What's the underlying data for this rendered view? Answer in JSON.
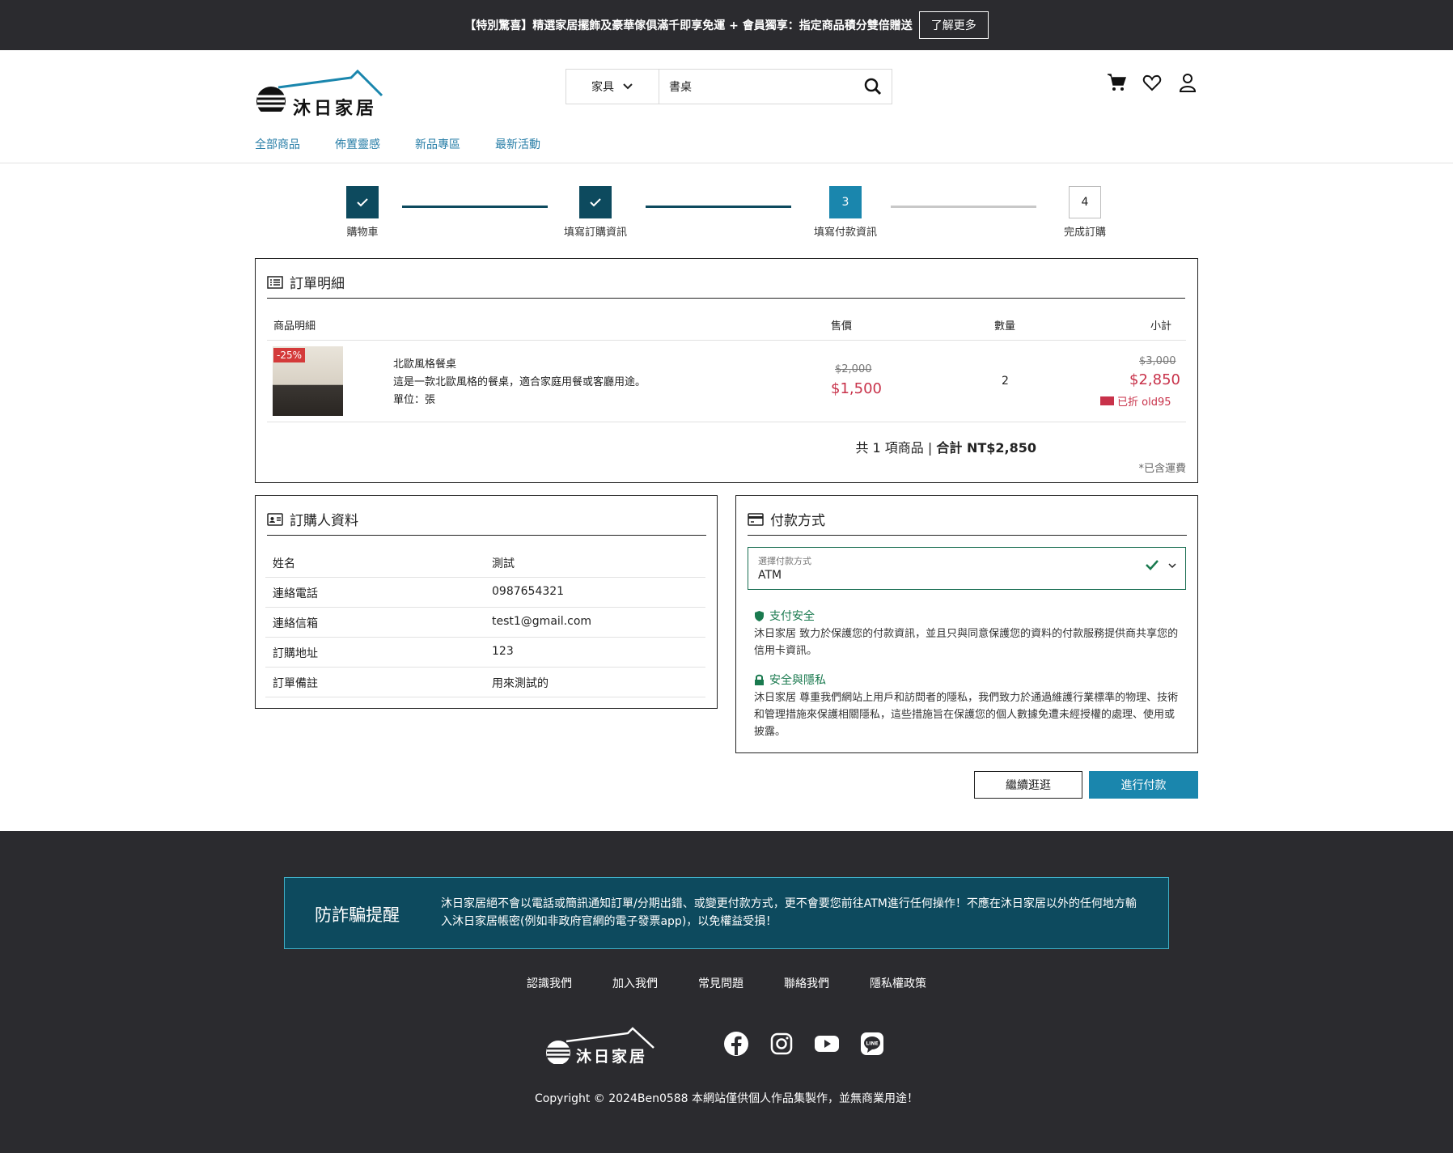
{
  "announcement": {
    "message": "【特別驚喜】精選家居擺飾及豪華傢俱滿千即享免運 + 會員獨享：指定商品積分雙倍贈送",
    "button": "了解更多"
  },
  "header": {
    "logo_text": "沐日家居",
    "search": {
      "category": "家具",
      "value": "書桌"
    },
    "icons": [
      "cart-icon",
      "heart-icon",
      "user-icon"
    ],
    "nav": [
      "全部商品",
      "佈置靈感",
      "新品專區",
      "最新活動"
    ]
  },
  "stepper": {
    "steps": [
      {
        "label": "購物車",
        "state": "done"
      },
      {
        "label": "填寫訂購資訊",
        "state": "done"
      },
      {
        "label": "填寫付款資訊",
        "state": "active",
        "number": "3"
      },
      {
        "label": "完成訂購",
        "state": "todo",
        "number": "4"
      }
    ]
  },
  "order": {
    "title": "訂單明細",
    "headers": {
      "item": "商品明細",
      "price": "售價",
      "qty": "數量",
      "subtotal": "小計"
    },
    "item": {
      "discount_tag": "-25%",
      "name": "北歐風格餐桌",
      "desc": "這是一款北歐風格的餐桌，適合家庭用餐或客廳用途。",
      "unit": "單位：張",
      "price_old": "$2,000",
      "price_new": "$1,500",
      "qty": "2",
      "subtotal_old": "$3,000",
      "subtotal_new": "$2,850",
      "coupon": "已折 old95"
    },
    "summary_count": "共 1 項商品 | ",
    "summary_total": "合計 NT$2,850",
    "shipping_note": "*已含運費"
  },
  "buyer": {
    "title": "訂購人資料",
    "rows": [
      {
        "k": "姓名",
        "v": "測試"
      },
      {
        "k": "連絡電話",
        "v": "0987654321"
      },
      {
        "k": "連絡信箱",
        "v": "test1@gmail.com"
      },
      {
        "k": "訂購地址",
        "v": "123"
      },
      {
        "k": "訂單備註",
        "v": "用來測試的"
      }
    ]
  },
  "payment": {
    "title": "付款方式",
    "select_label": "選擇付款方式",
    "select_value": "ATM",
    "security_title": "支付安全",
    "security_body": "沐日家居 致力於保護您的付款資訊，並且只與同意保護您的資料的付款服務提供商共享您的信用卡資訊。",
    "privacy_title": "安全與隱私",
    "privacy_body": "沐日家居 尊重我們網站上用戶和訪問者的隱私，我們致力於通過維護行業標準的物理、技術和管理措施來保護相關隱私，這些措施旨在保護您的個人數據免遭未經授權的處理、使用或披露。"
  },
  "actions": {
    "continue": "繼續逛逛",
    "pay": "進行付款"
  },
  "footer": {
    "fraud_title": "防詐騙提醒",
    "fraud_text": "沐日家居絕不會以電話或簡訊通知訂單/分期出錯、或變更付款方式，更不會要您前往ATM進行任何操作！不應在沐日家居以外的任何地方輸入沐日家居帳密(例如非政府官網的電子發票app)，以免權益受損！",
    "links": [
      "認識我們",
      "加入我們",
      "常見問題",
      "聯絡我們",
      "隱私權政策"
    ],
    "logo_text": "沐日家居",
    "social": [
      "facebook-icon",
      "instagram-icon",
      "youtube-icon",
      "line-icon"
    ],
    "copyright": "Copyright © 2024Ben0588 本網站僅供個人作品集製作，並無商業用途！"
  },
  "colors": {
    "dark": "#2b2b2f",
    "teal_dark": "#0d4a5e",
    "teal": "#1a86ad",
    "link": "#2a7fa8",
    "sale": "#c8324a",
    "green": "#1a7a4f"
  }
}
